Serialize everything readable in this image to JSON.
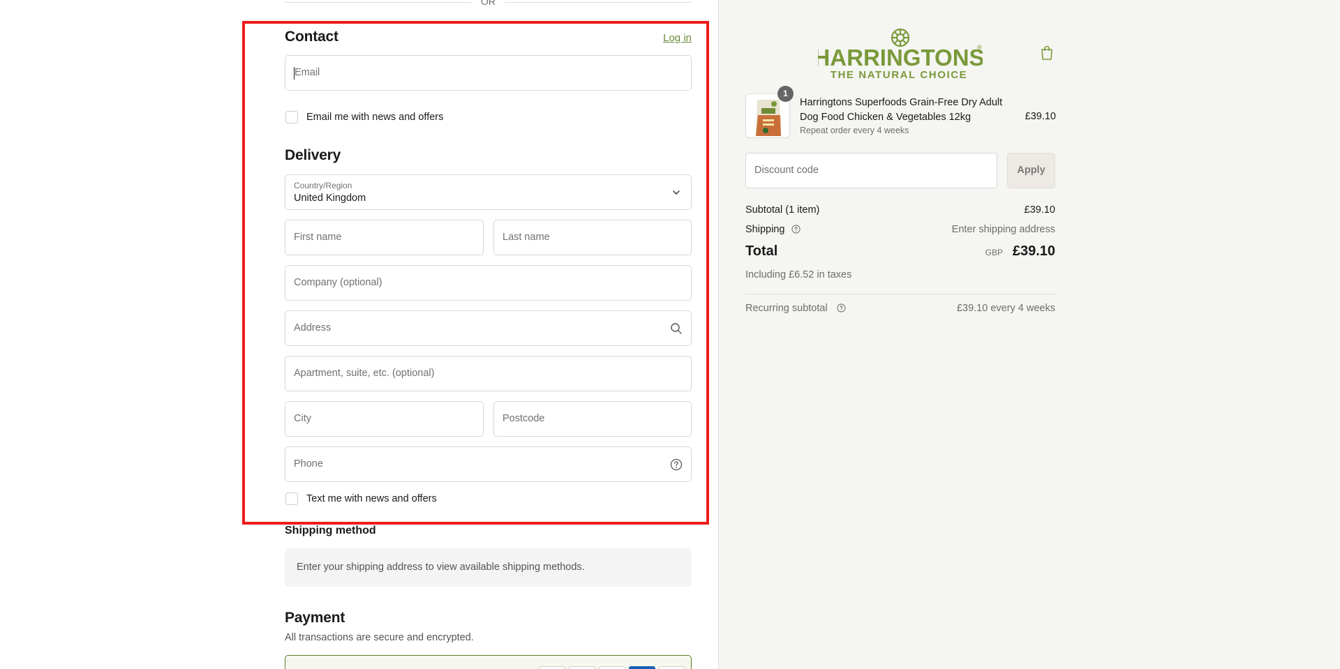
{
  "divider": {
    "or_text": "OR"
  },
  "contact": {
    "heading": "Contact",
    "login_link": "Log in",
    "email_placeholder": "Email",
    "newsletter_label": "Email me with news and offers"
  },
  "delivery": {
    "heading": "Delivery",
    "country_label": "Country/Region",
    "country_value": "United Kingdom",
    "first_name_placeholder": "First name",
    "last_name_placeholder": "Last name",
    "company_placeholder": "Company (optional)",
    "address_placeholder": "Address",
    "apartment_placeholder": "Apartment, suite, etc. (optional)",
    "city_placeholder": "City",
    "postcode_placeholder": "Postcode",
    "phone_placeholder": "Phone",
    "sms_label": "Text me with news and offers"
  },
  "shipping": {
    "heading": "Shipping method",
    "notice": "Enter your shipping address to view available shipping methods."
  },
  "payment": {
    "heading": "Payment",
    "subtitle": "All transactions are secure and encrypted."
  },
  "brand": {
    "name": "HARRINGTONS",
    "tagline": "THE NATURAL CHOICE",
    "color": "#7a9a3a"
  },
  "order": {
    "item_quantity": "1",
    "item_title": "Harringtons Superfoods Grain-Free Dry Adult Dog Food Chicken & Vegetables 12kg",
    "item_subscription": "Repeat order every 4 weeks",
    "item_price": "£39.10",
    "discount_placeholder": "Discount code",
    "apply_label": "Apply",
    "subtotal_label": "Subtotal (1 item)",
    "subtotal_value": "£39.10",
    "shipping_label": "Shipping",
    "shipping_value": "Enter shipping address",
    "total_label": "Total",
    "currency": "GBP",
    "total_value": "£39.10",
    "tax_note": "Including £6.52 in taxes",
    "recurring_label": "Recurring subtotal",
    "recurring_value": "£39.10 every 4 weeks"
  },
  "accent_colors": {
    "highlight": "#ee1c1c",
    "link": "#6b8b3a"
  }
}
